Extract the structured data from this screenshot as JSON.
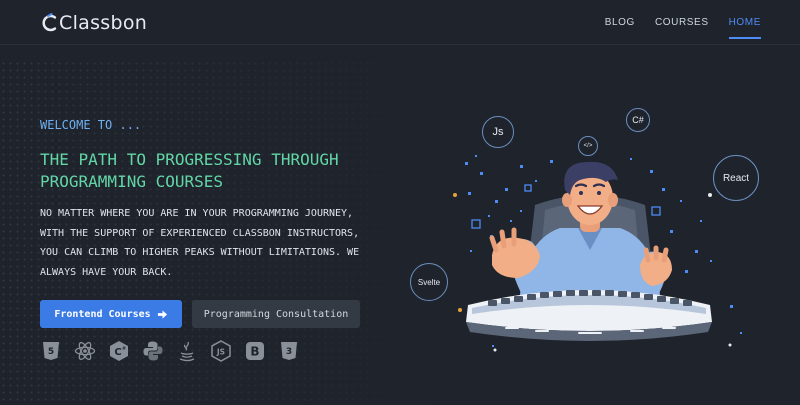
{
  "header": {
    "logo_text": "Classbon",
    "nav": [
      {
        "label": "BLOG",
        "active": false
      },
      {
        "label": "COURSES",
        "active": false
      },
      {
        "label": "HOME",
        "active": true
      }
    ]
  },
  "hero": {
    "welcome": "WELCOME TO ...",
    "headline": "THE PATH TO PROGRESSING THROUGH PROGRAMMING COURSES",
    "description": "NO MATTER WHERE YOU ARE IN YOUR PROGRAMMING JOURNEY, WITH THE SUPPORT OF EXPERIENCED CLASSBON INSTRUCTORS, YOU CAN CLIMB TO HIGHER PEAKS WITHOUT LIMITATIONS. WE ALWAYS HAVE YOUR BACK.",
    "primary_button": "Frontend Courses",
    "secondary_button": "Programming Consultation"
  },
  "tech_icons": [
    "html5-icon",
    "react-icon",
    "csharp-icon",
    "python-icon",
    "java-icon",
    "nodejs-icon",
    "bootstrap-icon",
    "css3-icon"
  ],
  "illustration": {
    "bubbles": {
      "js": "Js",
      "code": "</>",
      "csharp": "C#",
      "react": "React",
      "svelte": "Svelte"
    }
  },
  "colors": {
    "background": "#1f232b",
    "accent_blue": "#3b7be6",
    "headline_green": "#62d6a6",
    "welcome_blue": "#6fb0f2",
    "nav_active": "#4d8cf5"
  }
}
